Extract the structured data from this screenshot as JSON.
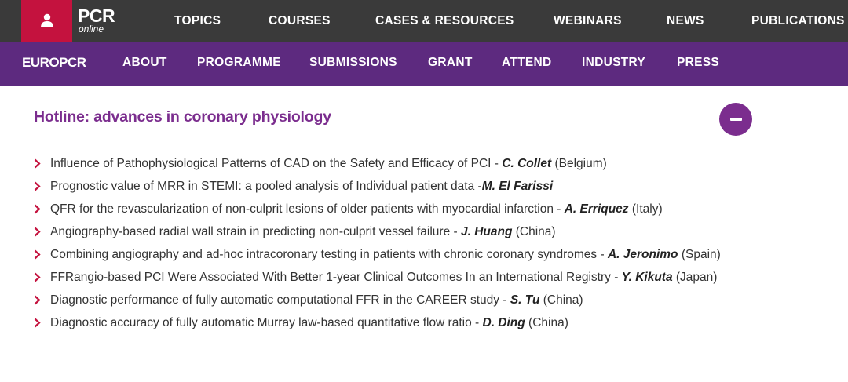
{
  "top_nav": {
    "logo_main": "PCR",
    "logo_sub": "online",
    "items": [
      "TOPICS",
      "COURSES",
      "CASES & RESOURCES",
      "WEBINARS",
      "NEWS",
      "PUBLICATIONS"
    ]
  },
  "sub_nav": {
    "brand": "EUROPCR",
    "items": [
      "ABOUT",
      "PROGRAMME",
      "SUBMISSIONS",
      "GRANT",
      "ATTEND",
      "INDUSTRY",
      "PRESS"
    ]
  },
  "session": {
    "title": "Hotline: advances in coronary physiology",
    "talks": [
      {
        "title": "Influence of Pathophysiological Patterns of CAD on the Safety and Efficacy of PCI - ",
        "speaker": "C. Collet",
        "country": " (Belgium)"
      },
      {
        "title": "Prognostic value of MRR in STEMI: a pooled analysis of Individual patient data -",
        "speaker": "M. El Farissi",
        "country": ""
      },
      {
        "title": "QFR for the revascularization of non-culprit lesions of older patients with myocardial infarction - ",
        "speaker": "A. Erriquez",
        "country": " (Italy)"
      },
      {
        "title": "Angiography-based radial wall strain in predicting non-culprit vessel failure - ",
        "speaker": "J. Huang",
        "country": " (China)"
      },
      {
        "title": "Combining angiography and ad-hoc intracoronary testing in patients with chronic coronary syndromes - ",
        "speaker": "A. Jeronimo",
        "country": " (Spain)"
      },
      {
        "title": "FFRangio-based PCI Were Associated With Better 1-year Clinical Outcomes In an International Registry - ",
        "speaker": "Y. Kikuta",
        "country": " (Japan)"
      },
      {
        "title": "Diagnostic performance of fully automatic computational FFR in the CAREER study - ",
        "speaker": "S. Tu",
        "country": " (China)"
      },
      {
        "title": "Diagnostic accuracy of fully automatic Murray law-based quantitative flow ratio - ",
        "speaker": "D. Ding",
        "country": " (China)"
      }
    ]
  },
  "colors": {
    "top_bar": "#3a3a3a",
    "user_box": "#c4123e",
    "purple_bar": "#5d2a7f",
    "accent": "#7b2d8e",
    "chevron": "#c4123e"
  },
  "icons": {
    "account": "user-icon",
    "collapse": "minus-icon",
    "bullet": "chevron-right-icon"
  }
}
